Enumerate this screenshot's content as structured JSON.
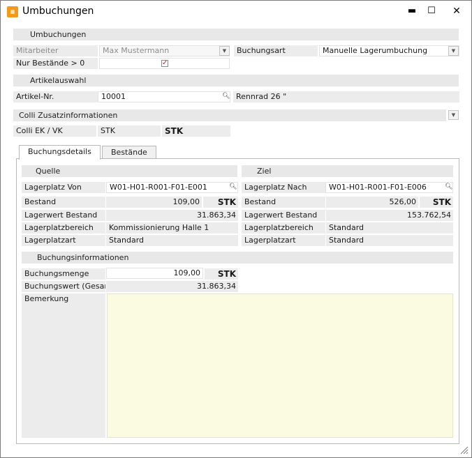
{
  "window": {
    "title": "Umbuchungen",
    "icon": "app-logo-icon",
    "controls": {
      "minimize": "▬",
      "maximize": "☐",
      "close": "✕"
    }
  },
  "umbuchungen": {
    "section_label": "Umbuchungen",
    "mitarbeiter_label": "Mitarbeiter",
    "mitarbeiter_value": "Max Mustermann",
    "buchungsart_label": "Buchungsart",
    "buchungsart_value": "Manuelle Lagerumbuchung",
    "nur_bestaende_label": "Nur Bestände > 0",
    "nur_bestaende_checked": true
  },
  "artikelauswahl": {
    "section_label": "Artikelauswahl",
    "artikel_nr_label": "Artikel-Nr.",
    "artikel_nr_value": "10001",
    "artikel_name": "Rennrad 26 \""
  },
  "colli": {
    "section_label": "Colli Zusatzinformationen",
    "ek_vk_label": "Colli EK / VK",
    "ek_vk_unit1": "STK",
    "ek_vk_unit2": "STK"
  },
  "tabs": [
    {
      "label": "Buchungsdetails",
      "active": true
    },
    {
      "label": "Bestände",
      "active": false
    }
  ],
  "quelle": {
    "section_label": "Quelle",
    "lagerplatz_label": "Lagerplatz Von",
    "lagerplatz_value": "W01-H01-R001-F01-E001",
    "bestand_label": "Bestand",
    "bestand_value": "109,00",
    "bestand_unit": "STK",
    "lagerwert_label": "Lagerwert Bestand",
    "lagerwert_value": "31.863,34",
    "bereich_label": "Lagerplatzbereich",
    "bereich_value": "Kommissionierung Halle 1",
    "art_label": "Lagerplatzart",
    "art_value": "Standard"
  },
  "ziel": {
    "section_label": "Ziel",
    "lagerplatz_label": "Lagerplatz Nach",
    "lagerplatz_value": "W01-H01-R001-F01-E006",
    "bestand_label": "Bestand",
    "bestand_value": "526,00",
    "bestand_unit": "STK",
    "lagerwert_label": "Lagerwert Bestand",
    "lagerwert_value": "153.762,54",
    "bereich_label": "Lagerplatzbereich",
    "bereich_value": "Standard",
    "art_label": "Lagerplatzart",
    "art_value": "Standard"
  },
  "buchungsinfo": {
    "section_label": "Buchungsinformationen",
    "menge_label": "Buchungsmenge",
    "menge_value": "109,00",
    "menge_unit": "STK",
    "wert_label": "Buchungswert (Gesamt)",
    "wert_value": "31.863,34",
    "bemerkung_label": "Bemerkung",
    "bemerkung_value": ""
  },
  "colors": {
    "section_bg": "#e8e8e8",
    "memo_bg": "#fbfbe2",
    "check_mark": "#c0202a",
    "app_icon": "#f29a1a"
  }
}
